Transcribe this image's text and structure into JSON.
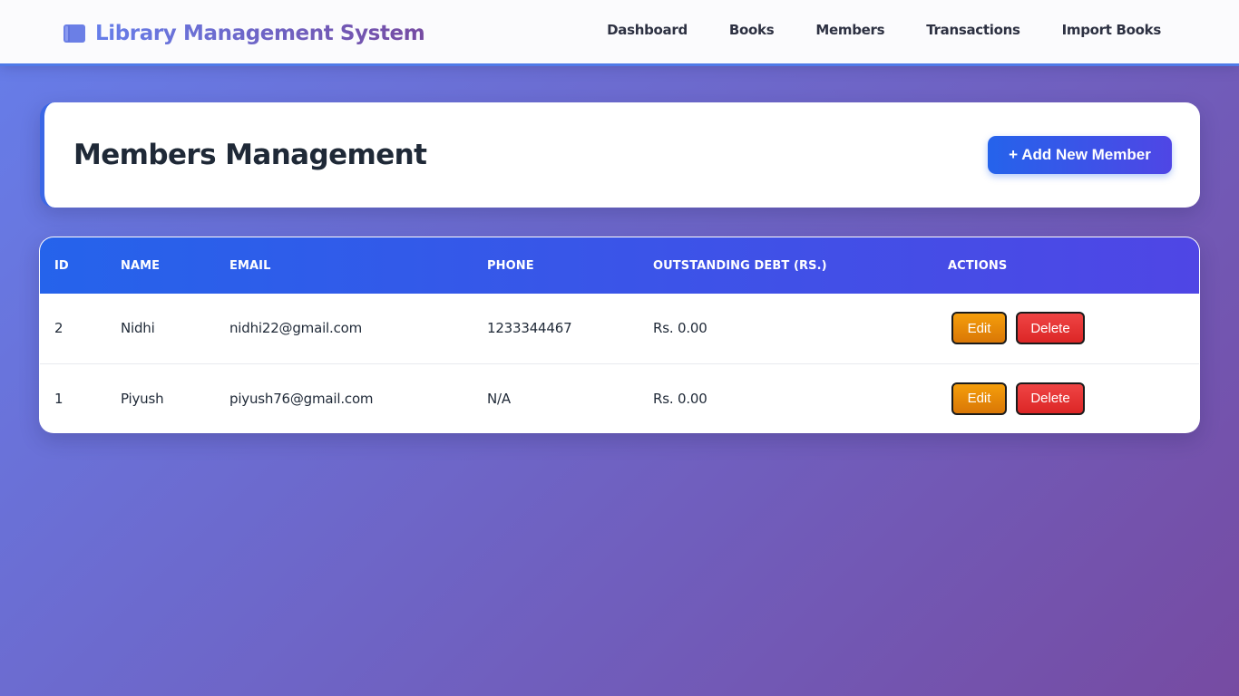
{
  "app": {
    "title": "Library Management System",
    "icon": "books-icon",
    "accent_color": "#667eea"
  },
  "nav": {
    "items": [
      {
        "label": "Dashboard"
      },
      {
        "label": "Books"
      },
      {
        "label": "Members"
      },
      {
        "label": "Transactions"
      },
      {
        "label": "Import Books"
      }
    ]
  },
  "header": {
    "title": "Members Management",
    "add_button_label": "+ Add New Member"
  },
  "table": {
    "columns": [
      "ID",
      "NAME",
      "EMAIL",
      "PHONE",
      "OUTSTANDING DEBT (RS.)",
      "ACTIONS"
    ],
    "rows": [
      {
        "id": "2",
        "name": "Nidhi",
        "email": "nidhi22@gmail.com",
        "phone": "1233344467",
        "debt": "Rs. 0.00",
        "edit_label": "Edit",
        "delete_label": "Delete"
      },
      {
        "id": "1",
        "name": "Piyush",
        "email": "piyush76@gmail.com",
        "phone": "N/A",
        "debt": "Rs. 0.00",
        "edit_label": "Edit",
        "delete_label": "Delete"
      }
    ]
  },
  "colors": {
    "header_gradient_start": "#2563eb",
    "header_gradient_end": "#4f46e5",
    "edit_button": "#f59e0b",
    "delete_button": "#ef4444"
  }
}
